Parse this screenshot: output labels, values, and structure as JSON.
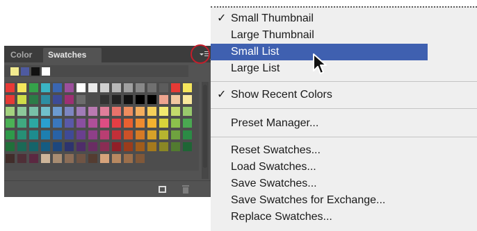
{
  "panel": {
    "tabs": [
      {
        "label": "Color",
        "active": false
      },
      {
        "label": "Swatches",
        "active": true
      }
    ],
    "recent_colors": [
      "#f2ea8f",
      "#4e5aa0",
      "#111111",
      "#ffffff"
    ],
    "swatch_rows": [
      [
        "#e83a36",
        "#f5e65c",
        "#35a24a",
        "#3ab5c5",
        "#3a66b1",
        "#9c4f9c",
        "#ffffff",
        "#eaeaea",
        "#d0d0d0",
        "#b8b8b8",
        "#a0a0a0",
        "#888888",
        "#707070",
        "#5c5c5c",
        "#e63a35",
        "#f5e65c"
      ],
      [
        "#e63a35",
        "#cfdc48",
        "#2c7b47",
        "#2c8ea3",
        "#3d4b97",
        "#9d2f73",
        "#6c6c6c",
        "#4c4c4c",
        "#333333",
        "#222222",
        "#111111",
        "#000000",
        "#000000",
        "#eda48f",
        "#f1c7a0",
        "#f8e89c"
      ],
      [
        "#a4d27f",
        "#8cc99a",
        "#78c0a8",
        "#70bfcc",
        "#6c9bd0",
        "#7d86c2",
        "#a07cb8",
        "#ba7ab2",
        "#e07e9a",
        "#e8736b",
        "#ee8d5e",
        "#f3ae5e",
        "#f5cf5a",
        "#f2ea70",
        "#c3da6c",
        "#99c96d"
      ],
      [
        "#4bb156",
        "#40a981",
        "#2ca8a3",
        "#2a9fd0",
        "#3a77bd",
        "#5a59a8",
        "#8a4fa0",
        "#ae4f98",
        "#dc4d83",
        "#e43e44",
        "#e86030",
        "#ee8b2f",
        "#f3b12f",
        "#d9d33a",
        "#8cc04c",
        "#4aa851"
      ],
      [
        "#2e9a4a",
        "#269076",
        "#1d8c8e",
        "#1d7fb0",
        "#2862a6",
        "#3f4a96",
        "#6a3f8f",
        "#8f3f88",
        "#b93e72",
        "#c22f38",
        "#cc5127",
        "#d67a25",
        "#d7a128",
        "#b7b42f",
        "#6fa33f",
        "#2b8b45"
      ],
      [
        "#206f3a",
        "#1b6956",
        "#15646a",
        "#155c82",
        "#1d477e",
        "#2d346e",
        "#4e2d69",
        "#6a2d63",
        "#8a2d54",
        "#911f28",
        "#9a3c1c",
        "#a15c1b",
        "#a4791d",
        "#8a8725",
        "#527b30",
        "#1f6535"
      ],
      [
        "#412d2a",
        "#4f2f37",
        "#5b2841",
        "#cdb59a",
        "#a88d72",
        "#8b6d57",
        "#6f5444",
        "#543c31",
        "#d6a37b",
        "#b88961",
        "#9c6f4b",
        "#805839"
      ]
    ]
  },
  "flyout": {
    "items": [
      {
        "label": "Small Thumbnail",
        "checked": true,
        "selected": false
      },
      {
        "label": "Large Thumbnail",
        "checked": false,
        "selected": false
      },
      {
        "label": "Small List",
        "checked": false,
        "selected": true
      },
      {
        "label": "Large List",
        "checked": false,
        "selected": false
      },
      {
        "label": "Show Recent Colors",
        "checked": true,
        "selected": false
      },
      {
        "label": "Preset Manager...",
        "checked": false,
        "selected": false
      },
      {
        "label": "Reset Swatches...",
        "checked": false,
        "selected": false
      },
      {
        "label": "Load Swatches...",
        "checked": false,
        "selected": false
      },
      {
        "label": "Save Swatches...",
        "checked": false,
        "selected": false
      },
      {
        "label": "Save Swatches for Exchange...",
        "checked": false,
        "selected": false
      },
      {
        "label": "Replace Swatches...",
        "checked": false,
        "selected": false
      }
    ],
    "check_glyph": "✓"
  },
  "colors": {
    "selection": "#3f60b0",
    "highlight_ring": "#c41e2b",
    "panel_bg": "#535353"
  }
}
